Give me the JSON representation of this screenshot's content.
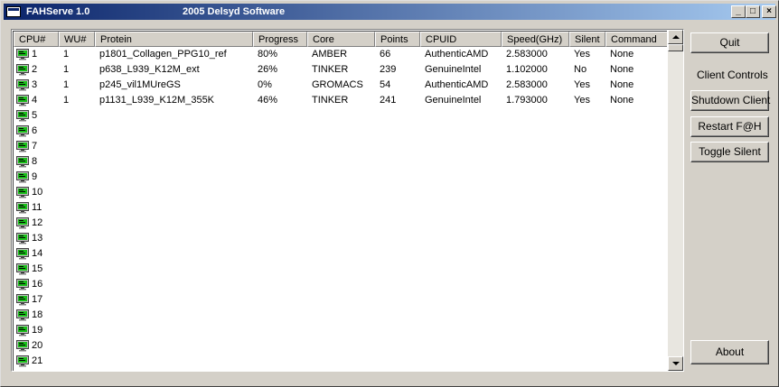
{
  "window": {
    "title": "FAHServe 1.0",
    "subtitle": "2005 Delsyd Software",
    "minimize_label": "_",
    "maximize_label": "□",
    "close_label": "×"
  },
  "columns": [
    "CPU#",
    "WU#",
    "Protein",
    "Progress",
    "Core",
    "Points",
    "CPUID",
    "Speed(GHz)",
    "Silent",
    "Command"
  ],
  "rows": [
    {
      "cpu": "1",
      "wu": "1",
      "protein": "p1801_Collagen_PPG10_ref",
      "progress": "80%",
      "core": "AMBER",
      "points": "66",
      "cpuid": "AuthenticAMD",
      "speed": "2.583000",
      "silent": "Yes",
      "command": "None"
    },
    {
      "cpu": "2",
      "wu": "1",
      "protein": "p638_L939_K12M_ext",
      "progress": "26%",
      "core": "TINKER",
      "points": "239",
      "cpuid": "GenuineIntel",
      "speed": "1.102000",
      "silent": "No",
      "command": "None"
    },
    {
      "cpu": "3",
      "wu": "1",
      "protein": "p245_vil1MUreGS",
      "progress": "0%",
      "core": "GROMACS",
      "points": "54",
      "cpuid": "AuthenticAMD",
      "speed": "2.583000",
      "silent": "Yes",
      "command": "None"
    },
    {
      "cpu": "4",
      "wu": "1",
      "protein": "p1131_L939_K12M_355K",
      "progress": "46%",
      "core": "TINKER",
      "points": "241",
      "cpuid": "GenuineIntel",
      "speed": "1.793000",
      "silent": "Yes",
      "command": "None"
    },
    {
      "cpu": "5",
      "wu": "",
      "protein": "",
      "progress": "",
      "core": "",
      "points": "",
      "cpuid": "",
      "speed": "",
      "silent": "",
      "command": ""
    },
    {
      "cpu": "6",
      "wu": "",
      "protein": "",
      "progress": "",
      "core": "",
      "points": "",
      "cpuid": "",
      "speed": "",
      "silent": "",
      "command": ""
    },
    {
      "cpu": "7",
      "wu": "",
      "protein": "",
      "progress": "",
      "core": "",
      "points": "",
      "cpuid": "",
      "speed": "",
      "silent": "",
      "command": ""
    },
    {
      "cpu": "8",
      "wu": "",
      "protein": "",
      "progress": "",
      "core": "",
      "points": "",
      "cpuid": "",
      "speed": "",
      "silent": "",
      "command": ""
    },
    {
      "cpu": "9",
      "wu": "",
      "protein": "",
      "progress": "",
      "core": "",
      "points": "",
      "cpuid": "",
      "speed": "",
      "silent": "",
      "command": ""
    },
    {
      "cpu": "10",
      "wu": "",
      "protein": "",
      "progress": "",
      "core": "",
      "points": "",
      "cpuid": "",
      "speed": "",
      "silent": "",
      "command": ""
    },
    {
      "cpu": "11",
      "wu": "",
      "protein": "",
      "progress": "",
      "core": "",
      "points": "",
      "cpuid": "",
      "speed": "",
      "silent": "",
      "command": ""
    },
    {
      "cpu": "12",
      "wu": "",
      "protein": "",
      "progress": "",
      "core": "",
      "points": "",
      "cpuid": "",
      "speed": "",
      "silent": "",
      "command": ""
    },
    {
      "cpu": "13",
      "wu": "",
      "protein": "",
      "progress": "",
      "core": "",
      "points": "",
      "cpuid": "",
      "speed": "",
      "silent": "",
      "command": ""
    },
    {
      "cpu": "14",
      "wu": "",
      "protein": "",
      "progress": "",
      "core": "",
      "points": "",
      "cpuid": "",
      "speed": "",
      "silent": "",
      "command": ""
    },
    {
      "cpu": "15",
      "wu": "",
      "protein": "",
      "progress": "",
      "core": "",
      "points": "",
      "cpuid": "",
      "speed": "",
      "silent": "",
      "command": ""
    },
    {
      "cpu": "16",
      "wu": "",
      "protein": "",
      "progress": "",
      "core": "",
      "points": "",
      "cpuid": "",
      "speed": "",
      "silent": "",
      "command": ""
    },
    {
      "cpu": "17",
      "wu": "",
      "protein": "",
      "progress": "",
      "core": "",
      "points": "",
      "cpuid": "",
      "speed": "",
      "silent": "",
      "command": ""
    },
    {
      "cpu": "18",
      "wu": "",
      "protein": "",
      "progress": "",
      "core": "",
      "points": "",
      "cpuid": "",
      "speed": "",
      "silent": "",
      "command": ""
    },
    {
      "cpu": "19",
      "wu": "",
      "protein": "",
      "progress": "",
      "core": "",
      "points": "",
      "cpuid": "",
      "speed": "",
      "silent": "",
      "command": ""
    },
    {
      "cpu": "20",
      "wu": "",
      "protein": "",
      "progress": "",
      "core": "",
      "points": "",
      "cpuid": "",
      "speed": "",
      "silent": "",
      "command": ""
    },
    {
      "cpu": "21",
      "wu": "",
      "protein": "",
      "progress": "",
      "core": "",
      "points": "",
      "cpuid": "",
      "speed": "",
      "silent": "",
      "command": ""
    }
  ],
  "row_icon": "monitor-icon",
  "sidebar": {
    "quit_label": "Quit",
    "client_controls_label": "Client Controls",
    "shutdown_label": "Shutdown Client",
    "restart_label": "Restart F@H",
    "toggle_silent_label": "Toggle Silent",
    "about_label": "About"
  },
  "colors": {
    "titlebar_start": "#0a246a",
    "titlebar_end": "#a6caf0",
    "face": "#d4d0c8",
    "monitor_screen": "#18c018"
  }
}
